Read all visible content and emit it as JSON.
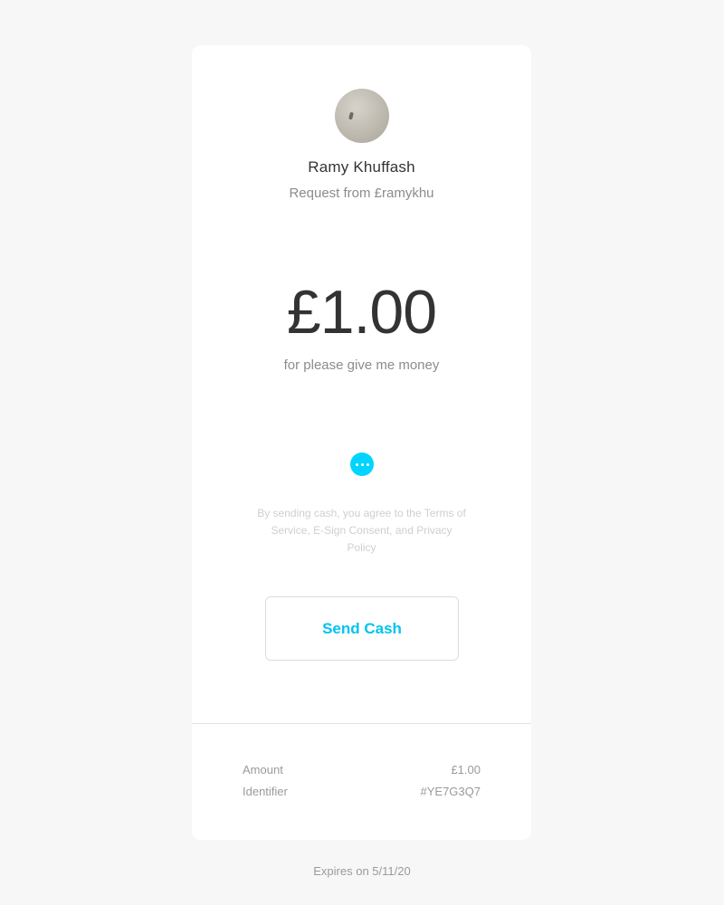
{
  "request": {
    "name": "Ramy Khuffash",
    "subtitle": "Request from £ramykhu",
    "avatar_icon": "user-avatar",
    "amount": "£1.00",
    "note": "for please give me money"
  },
  "actions": {
    "more_icon": "more-dots-icon",
    "legal_text": "By sending cash, you agree to the Terms of Service, E-Sign Consent, and Privacy Policy",
    "send_label": "Send Cash"
  },
  "details": {
    "amount_label": "Amount",
    "amount_value": "£1.00",
    "identifier_label": "Identifier",
    "identifier_value": "#YE7G3Q7"
  },
  "footer": {
    "expires": "Expires on 5/11/20"
  },
  "colors": {
    "accent": "#00d4ff",
    "background": "#f7f7f7",
    "card": "#ffffff"
  }
}
